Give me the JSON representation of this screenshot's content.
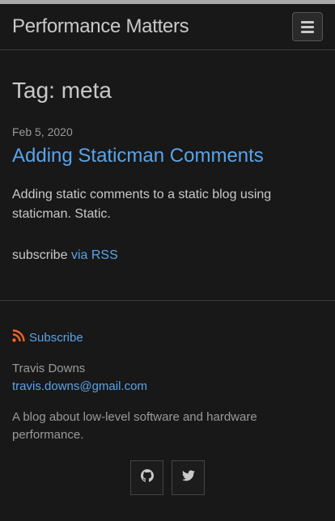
{
  "header": {
    "site_title": "Performance Matters"
  },
  "main": {
    "page_title": "Tag: meta",
    "posts": [
      {
        "date": "Feb 5, 2020",
        "title": "Adding Staticman Comments",
        "excerpt": "Adding static comments to a static blog using staticman. Static."
      }
    ],
    "subscribe_prefix": "subscribe",
    "subscribe_link": "via RSS"
  },
  "footer": {
    "rss_label": "Subscribe",
    "author_name": "Travis Downs",
    "author_email": "travis.downs@gmail.com",
    "description": "A blog about low-level software and hardware performance.",
    "social": [
      {
        "icon": "github-icon"
      },
      {
        "icon": "twitter-icon"
      }
    ]
  },
  "colors": {
    "accent": "#5aa3e8",
    "rss": "#f26522",
    "background": "#181818"
  }
}
